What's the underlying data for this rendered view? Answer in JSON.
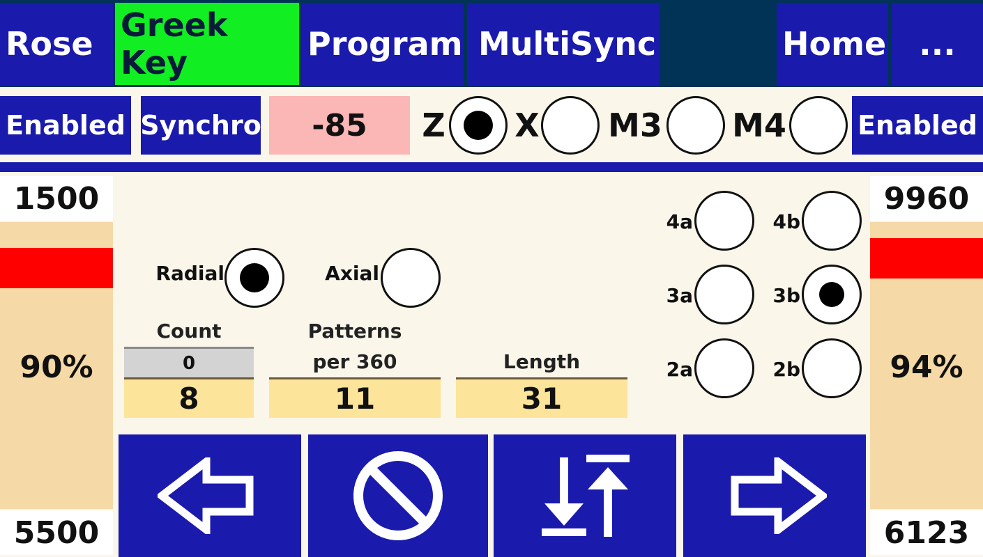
{
  "tabs": {
    "rose": "Rose",
    "greek_key": "Greek Key",
    "program": "Program",
    "multisync": "MultiSync",
    "home": "Home",
    "more": "..."
  },
  "toolbar": {
    "left_status": "Enabled",
    "synchro": "Synchro",
    "value": "-85",
    "axes": [
      {
        "label": "Z",
        "selected": true
      },
      {
        "label": "X",
        "selected": false
      },
      {
        "label": "M3",
        "selected": false
      },
      {
        "label": "M4",
        "selected": false
      }
    ],
    "right_status": "Enabled"
  },
  "left_panel": {
    "top_value": "1500",
    "percent": "90%",
    "level": 0.9,
    "bottom_value": "5500"
  },
  "right_panel": {
    "top_value": "9960",
    "percent": "94%",
    "level": 0.94,
    "bottom_value": "6123"
  },
  "mode": {
    "radial_label": "Radial",
    "radial_selected": true,
    "axial_label": "Axial",
    "axial_selected": false
  },
  "fields": {
    "count_label": "Count",
    "count_progress": "0",
    "count_value": "8",
    "patterns_label_line1": "Patterns",
    "patterns_label_line2": "per 360",
    "patterns_value": "11",
    "length_label": "Length",
    "length_value": "31"
  },
  "positions": [
    {
      "label": "4a",
      "selected": false
    },
    {
      "label": "4b",
      "selected": false
    },
    {
      "label": "3a",
      "selected": false
    },
    {
      "label": "3b",
      "selected": true
    },
    {
      "label": "2a",
      "selected": false
    },
    {
      "label": "2b",
      "selected": false
    }
  ],
  "actions": {
    "prev_icon": "arrow-left-icon",
    "stop_icon": "prohibit-icon",
    "swap_icon": "sort-arrows-icon",
    "next_icon": "arrow-right-icon"
  },
  "colors": {
    "button_blue": "#1a1aad",
    "active_tab": "#11ee22",
    "value_highlight": "#fbb6b6",
    "level_marker": "#ff0000",
    "field_yellow": "#fce49a"
  }
}
